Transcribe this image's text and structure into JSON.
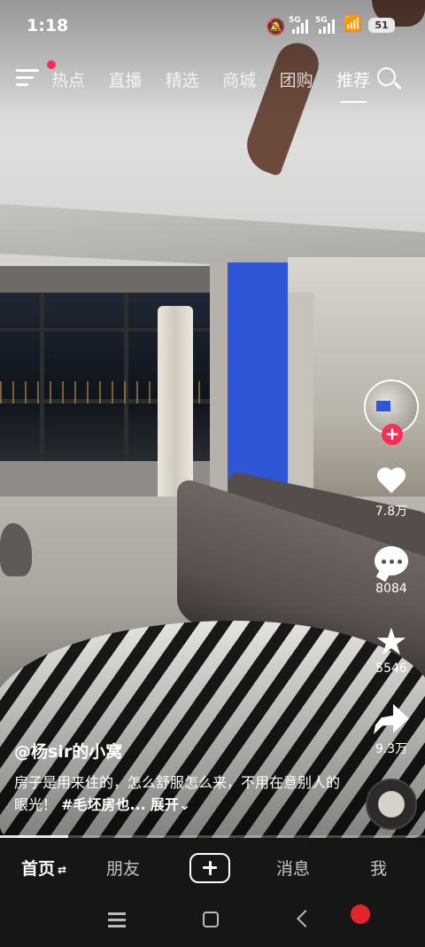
{
  "status_bar": {
    "time": "1:18",
    "network_1": "5G",
    "network_2": "5G",
    "battery": "51"
  },
  "top_nav": {
    "tabs": [
      {
        "label": "热点",
        "active": false
      },
      {
        "label": "直播",
        "active": false
      },
      {
        "label": "精选",
        "active": false
      },
      {
        "label": "商城",
        "active": false
      },
      {
        "label": "团购",
        "active": false
      },
      {
        "label": "推荐",
        "active": true
      }
    ],
    "icons": [
      "menu-icon",
      "search-icon"
    ]
  },
  "actions": {
    "follow": "+",
    "likes": "7.8万",
    "comments": "8084",
    "favorites": "5546",
    "shares": "9.3万"
  },
  "caption": {
    "author": "@杨sir的小窝",
    "description": "房子是用来住的，怎么舒服怎么来，不用在意别人的眼光！",
    "hashtag": "#毛坯房也...",
    "expand": "展开"
  },
  "video_progress": 0.16,
  "bottom_tabs": [
    {
      "label": "首页",
      "active": true
    },
    {
      "label": "朋友",
      "active": false
    },
    {
      "label": "消息",
      "active": false
    },
    {
      "label": "我",
      "active": false
    }
  ],
  "colors": {
    "accent": "#fe2c55",
    "blue_wall": "#2f56d6",
    "bar_bg": "#161616"
  }
}
